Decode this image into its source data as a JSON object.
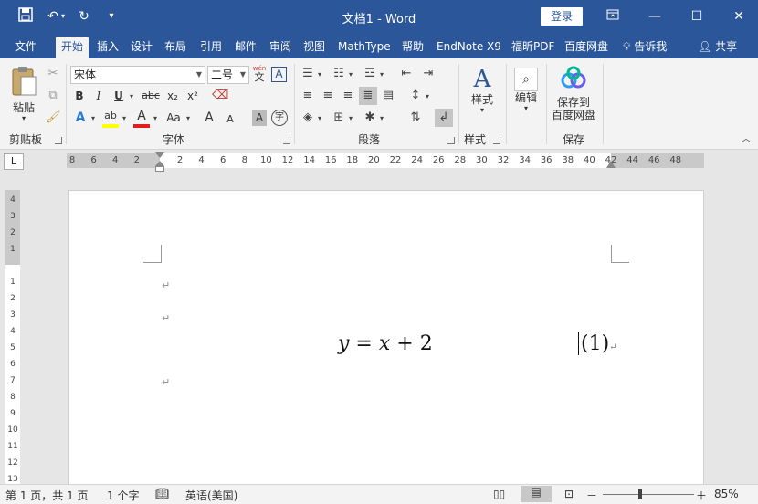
{
  "titlebar": {
    "title": "文档1  -  Word",
    "login": "登录",
    "save_icon": "save-icon",
    "undo_icon": "undo-icon",
    "redo_icon": "redo-icon",
    "customize_icon": "customize-qat-icon"
  },
  "tabs": [
    "文件",
    "开始",
    "插入",
    "设计",
    "布局",
    "引用",
    "邮件",
    "审阅",
    "视图",
    "MathType",
    "帮助",
    "EndNote X9",
    "福昕PDF",
    "百度网盘"
  ],
  "active_tab": "开始",
  "tellme": "告诉我",
  "share": "共享",
  "ribbon": {
    "clipboard": {
      "paste": "粘贴",
      "label": "剪贴板"
    },
    "font": {
      "name": "宋体",
      "size": "二号",
      "wen_top": "wén",
      "wen_bottom": "文",
      "label": "字体",
      "bold": "B",
      "italic": "I",
      "underline": "U",
      "strike": "abc",
      "sub": "x₂",
      "sup": "x²",
      "font_color": "A",
      "highlight": "ab",
      "case": "Aa",
      "grow": "A",
      "shrink": "A",
      "border_char": "A",
      "enclosed": "字",
      "A_box": "A"
    },
    "paragraph": {
      "label": "段落"
    },
    "styles": {
      "btn": "样式",
      "label": "样式"
    },
    "editing": {
      "btn": "编辑"
    },
    "save": {
      "btn_line1": "保存到",
      "btn_line2": "百度网盘",
      "label": "保存"
    }
  },
  "ruler": {
    "corner": "L",
    "ticks": [
      "8",
      "6",
      "4",
      "2",
      "",
      "2",
      "4",
      "6",
      "8",
      "10",
      "12",
      "14",
      "16",
      "18",
      "20",
      "22",
      "24",
      "26",
      "28",
      "30",
      "32",
      "34",
      "36",
      "38",
      "40",
      "42",
      "44",
      "46",
      "48"
    ],
    "vticks": [
      "4",
      "3",
      "2",
      "1",
      "",
      "1",
      "2",
      "3",
      "4",
      "5",
      "6",
      "7",
      "8",
      "9",
      "10",
      "11",
      "12",
      "13"
    ]
  },
  "document": {
    "para_mark": "↵",
    "equation": {
      "y": "y",
      "eq": " = ",
      "x": "x",
      "plus": " + ",
      "two": "2"
    },
    "eqnum": "(1)"
  },
  "status": {
    "page": "第 1 页，共 1 页",
    "words": "1 个字",
    "lang": "英语(美国)",
    "zoom": "85%",
    "minus": "－",
    "plus": "＋"
  }
}
